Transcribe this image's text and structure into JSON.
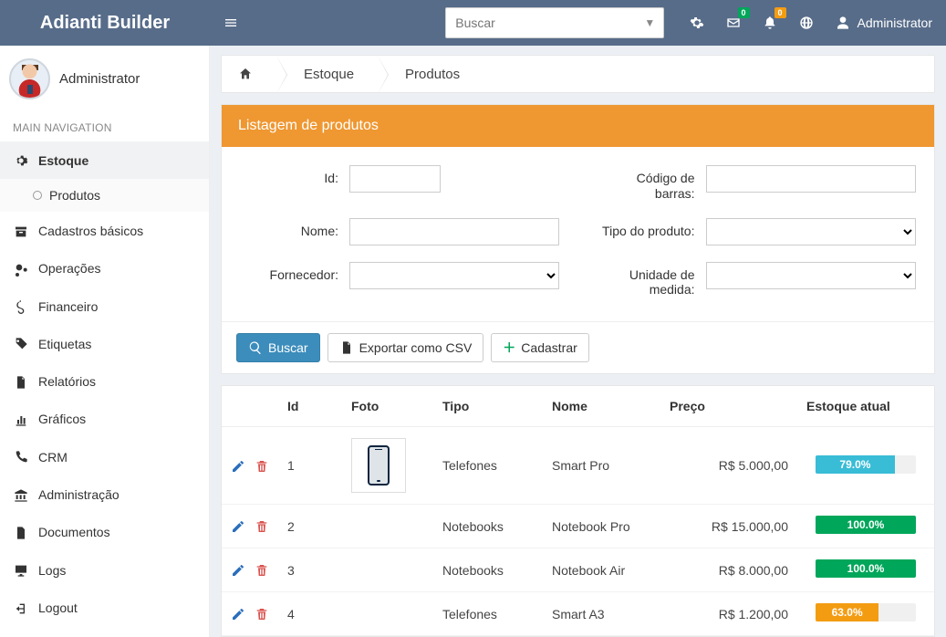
{
  "header": {
    "logo": "Adianti Builder",
    "search_placeholder": "Buscar",
    "mail_badge": "0",
    "bell_badge": "0",
    "user_name": "Administrator"
  },
  "sidebar": {
    "user_name": "Administrator",
    "section_label": "MAIN NAVIGATION",
    "items": [
      {
        "label": "Estoque",
        "icon": "cogs",
        "active": true,
        "children": [
          {
            "label": "Produtos",
            "active": true
          }
        ]
      },
      {
        "label": "Cadastros básicos",
        "icon": "archive"
      },
      {
        "label": "Operações",
        "icon": "cogs2"
      },
      {
        "label": "Financeiro",
        "icon": "dollar"
      },
      {
        "label": "Etiquetas",
        "icon": "tag"
      },
      {
        "label": "Relatórios",
        "icon": "file"
      },
      {
        "label": "Gráficos",
        "icon": "chart"
      },
      {
        "label": "CRM",
        "icon": "phone"
      },
      {
        "label": "Administração",
        "icon": "institution"
      },
      {
        "label": "Documentos",
        "icon": "doc"
      },
      {
        "label": "Logs",
        "icon": "monitor"
      },
      {
        "label": "Logout",
        "icon": "logout"
      }
    ]
  },
  "breadcrumb": {
    "items": [
      "Estoque",
      "Produtos"
    ]
  },
  "panel": {
    "title": "Listagem de produtos",
    "form": {
      "id_label": "Id:",
      "nome_label": "Nome:",
      "fornecedor_label": "Fornecedor:",
      "codigo_barras_label": "Código de barras:",
      "tipo_produto_label": "Tipo do produto:",
      "unidade_medida_label": "Unidade de medida:"
    },
    "buttons": {
      "buscar": "Buscar",
      "exportar": "Exportar como CSV",
      "cadastrar": "Cadastrar"
    }
  },
  "table": {
    "headers": {
      "id": "Id",
      "foto": "Foto",
      "tipo": "Tipo",
      "nome": "Nome",
      "preco": "Preço",
      "estoque": "Estoque atual"
    },
    "rows": [
      {
        "id": "1",
        "tipo": "Telefones",
        "nome": "Smart Pro",
        "preco": "R$ 5.000,00",
        "estoque_pct": "79.0%",
        "pb_class": "pb-79",
        "has_foto": true
      },
      {
        "id": "2",
        "tipo": "Notebooks",
        "nome": "Notebook Pro",
        "preco": "R$ 15.000,00",
        "estoque_pct": "100.0%",
        "pb_class": "pb-100",
        "has_foto": false
      },
      {
        "id": "3",
        "tipo": "Notebooks",
        "nome": "Notebook Air",
        "preco": "R$ 8.000,00",
        "estoque_pct": "100.0%",
        "pb_class": "pb-100",
        "has_foto": false
      },
      {
        "id": "4",
        "tipo": "Telefones",
        "nome": "Smart A3",
        "preco": "R$ 1.200,00",
        "estoque_pct": "63.0%",
        "pb_class": "pb-63",
        "has_foto": false
      }
    ]
  }
}
